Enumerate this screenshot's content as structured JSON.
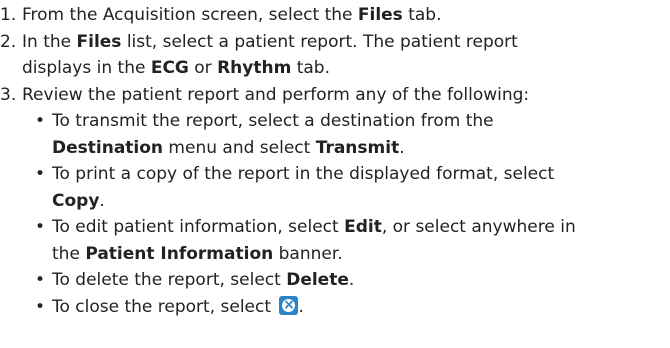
{
  "steps": [
    {
      "num": "1.",
      "a": "From the Acquisition screen, select the ",
      "b": "Files",
      "c": " tab."
    },
    {
      "num": "2.",
      "a": "In the ",
      "b": "Files",
      "c": " list, select a patient report. The patient report",
      "d": "displays in the ",
      "e": "ECG",
      "f": " or ",
      "g": "Rhythm",
      "h": " tab."
    },
    {
      "num": "3.",
      "a": "Review the patient report and perform any of the following:"
    }
  ],
  "bullets": [
    {
      "a": "To transmit the report, select a destination from the",
      "b": "Destination",
      "c": " menu and select ",
      "d": "Transmit",
      "e": "."
    },
    {
      "a": "To print a copy of the report in the displayed format, select",
      "b": "Copy",
      "c": "."
    },
    {
      "a": "To edit patient information, select ",
      "b": "Edit",
      "c": ", or select anywhere in",
      "d": "the ",
      "e": "Patient Information",
      "f": " banner."
    },
    {
      "a": "To delete the report, select ",
      "b": "Delete",
      "c": "."
    },
    {
      "a": "To close the report, select ",
      "icon": "close-icon",
      "c": "."
    }
  ],
  "bullet_char": "•",
  "icon_color": "#2a84c5"
}
